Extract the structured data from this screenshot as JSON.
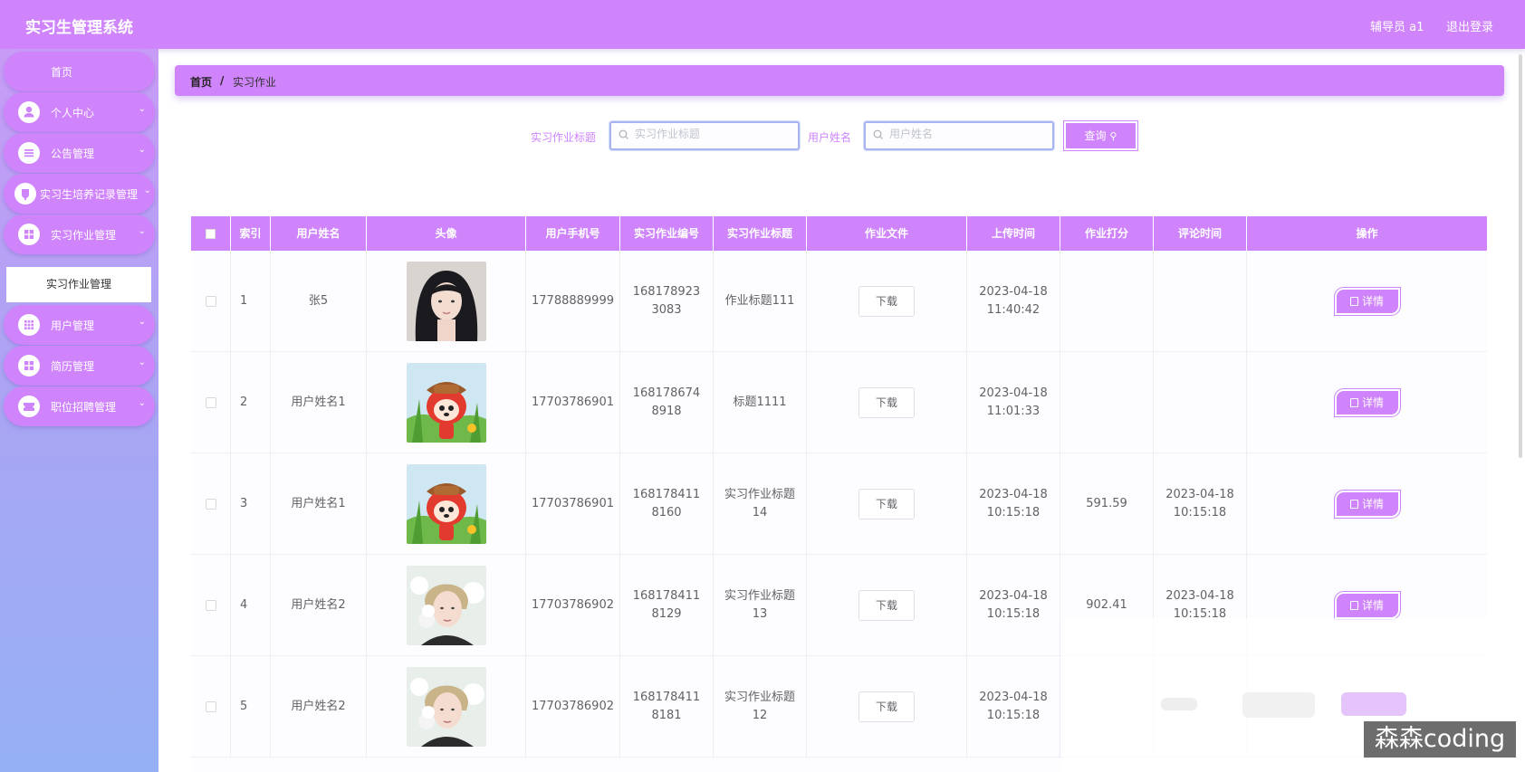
{
  "app": {
    "title": "实习生管理系统",
    "user_label": "辅导员 a1",
    "logout": "退出登录"
  },
  "sidebar": {
    "home": "首页",
    "items": [
      {
        "label": "个人中心",
        "icon": "user-icon"
      },
      {
        "label": "公告管理",
        "icon": "list-icon"
      },
      {
        "label": "实习生培养记录管理",
        "icon": "cup-icon"
      },
      {
        "label": "实习作业管理",
        "icon": "grid-icon"
      },
      {
        "label": "用户管理",
        "icon": "grid-icon"
      },
      {
        "label": "简历管理",
        "icon": "grid-icon"
      },
      {
        "label": "职位招聘管理",
        "icon": "ticket-icon"
      }
    ],
    "active_sub": "实习作业管理"
  },
  "breadcrumb": {
    "home": "首页",
    "sep": "/",
    "current": "实习作业"
  },
  "search": {
    "title_label": "实习作业标题",
    "title_placeholder": "实习作业标题",
    "name_label": "用户姓名",
    "name_placeholder": "用户姓名",
    "button": "查询"
  },
  "table": {
    "headers": [
      "索引",
      "用户姓名",
      "头像",
      "用户手机号",
      "实习作业编号",
      "实习作业标题",
      "作业文件",
      "上传时间",
      "作业打分",
      "评论时间",
      "操作"
    ],
    "download_label": "下载",
    "detail_label": "详情",
    "rows": [
      {
        "index": "1",
        "name": "张5",
        "avatar": "girl-photo",
        "phone": "17788889999",
        "code": "1681789233083",
        "title": "作业标题111",
        "upload": "2023-04-18 11:40:42",
        "score": "",
        "comment_time": ""
      },
      {
        "index": "2",
        "name": "用户姓名1",
        "avatar": "cartoon-fox",
        "phone": "17703786901",
        "code": "1681786748918",
        "title": "标题1111",
        "upload": "2023-04-18 11:01:33",
        "score": "",
        "comment_time": ""
      },
      {
        "index": "3",
        "name": "用户姓名1",
        "avatar": "cartoon-fox",
        "phone": "17703786901",
        "code": "1681784118160",
        "title": "实习作业标题14",
        "upload": "2023-04-18 10:15:18",
        "score": "591.59",
        "comment_time": "2023-04-18 10:15:18"
      },
      {
        "index": "4",
        "name": "用户姓名2",
        "avatar": "boy-photo",
        "phone": "17703786902",
        "code": "1681784118129",
        "title": "实习作业标题13",
        "upload": "2023-04-18 10:15:18",
        "score": "902.41",
        "comment_time": "2023-04-18 10:15:18"
      },
      {
        "index": "5",
        "name": "用户姓名2",
        "avatar": "boy-photo",
        "phone": "17703786902",
        "code": "1681784118181",
        "title": "实习作业标题12",
        "upload": "2023-04-18 10:15:18",
        "score": "",
        "comment_time": ""
      }
    ]
  },
  "watermark": "森森coding",
  "colors": {
    "accent": "#cf84fb",
    "sidebar_bottom": "#96b0f5"
  }
}
